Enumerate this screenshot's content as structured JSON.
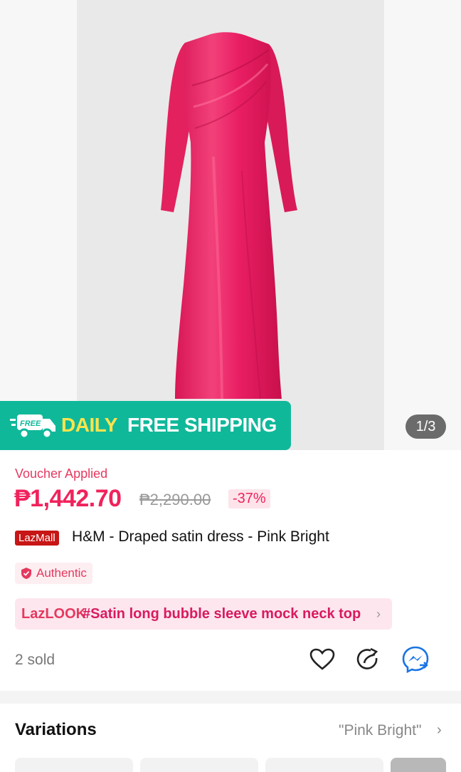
{
  "gallery": {
    "counter": "1/3"
  },
  "shipping_banner": {
    "free_tag": "FREE",
    "daily": "DAILY",
    "free_shipping": "FREE SHIPPING"
  },
  "pricing": {
    "voucher_label": "Voucher Applied",
    "price": "₱1,442.70",
    "original_price": "₱2,290.00",
    "discount": "-37%"
  },
  "product": {
    "mall_badge": "LazMall",
    "title": "H&M - Draped satin dress - Pink Bright",
    "authentic_label": "Authentic"
  },
  "lazlook": {
    "logo": "LazLOOK",
    "tag": "#Satin long bubble sleeve mock neck top"
  },
  "stats": {
    "sold": "2 sold"
  },
  "variations": {
    "title": "Variations",
    "selected": "\"Pink Bright\""
  },
  "colors": {
    "accent": "#f0225c",
    "shipping_green": "#10b89a",
    "daily_yellow": "#ffe44d",
    "dress_pink": "#e91e63"
  },
  "icons": [
    "heart-icon",
    "share-icon",
    "messenger-icon",
    "truck-icon",
    "shield-check-icon",
    "chevron-right-icon"
  ]
}
